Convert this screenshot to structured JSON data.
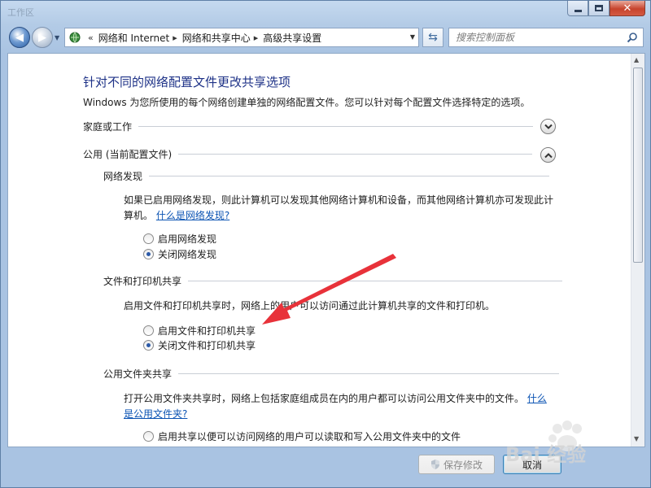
{
  "window": {
    "title": "工作区",
    "minimize": "minimize",
    "maximize": "maximize",
    "close": "close"
  },
  "navbar": {
    "overflow_marker": "«",
    "breadcrumbs": [
      "网络和 Internet",
      "网络和共享中心",
      "高级共享设置"
    ],
    "search_placeholder": "搜索控制面板"
  },
  "page": {
    "title": "针对不同的网络配置文件更改共享选项",
    "description": "Windows 为您所使用的每个网络创建单独的网络配置文件。您可以针对每个配置文件选择特定的选项。",
    "profiles": [
      {
        "label": "家庭或工作",
        "expanded": false
      },
      {
        "label": "公用 (当前配置文件)",
        "expanded": true
      }
    ],
    "network_discovery": {
      "heading": "网络发现",
      "text": "如果已启用网络发现，则此计算机可以发现其他网络计算机和设备，而其他网络计算机亦可发现此计算机。",
      "link": "什么是网络发现?",
      "options": [
        "启用网络发现",
        "关闭网络发现"
      ],
      "selected": 1
    },
    "file_printer_sharing": {
      "heading": "文件和打印机共享",
      "text": "启用文件和打印机共享时，网络上的用户可以访问通过此计算机共享的文件和打印机。",
      "options": [
        "启用文件和打印机共享",
        "关闭文件和打印机共享"
      ],
      "selected": 1
    },
    "public_folder_sharing": {
      "heading": "公用文件夹共享",
      "text": "打开公用文件夹共享时，网络上包括家庭组成员在内的用户都可以访问公用文件夹中的文件。",
      "link_part1": "什么",
      "link_part2": "是公用文件夹?",
      "options": [
        "启用共享以便可以访问网络的用户可以读取和写入公用文件夹中的文件"
      ]
    }
  },
  "buttons": {
    "save": "保存修改",
    "cancel": "取消"
  },
  "colors": {
    "title_blue": "#1e3287",
    "link_blue": "#0b53b3",
    "annotation_red": "#e8323a"
  },
  "watermark": {
    "text": "Bai 经验"
  }
}
